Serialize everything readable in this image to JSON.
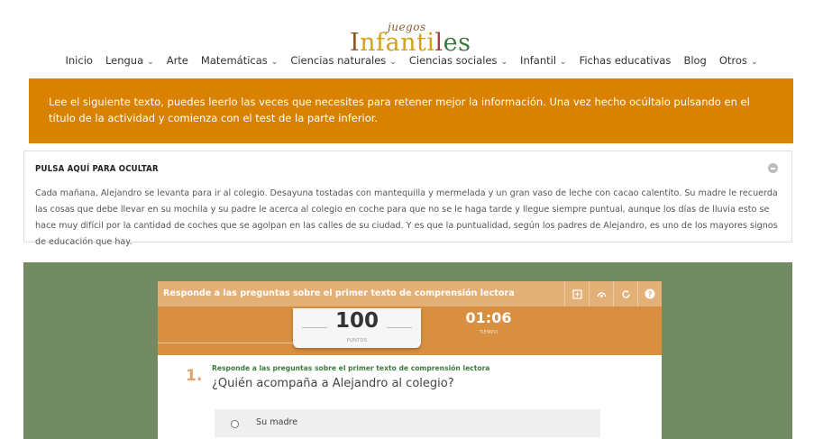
{
  "logo": {
    "small": "juegos",
    "main_parts": [
      "I",
      "nfanti",
      "l",
      "es"
    ]
  },
  "nav": {
    "items": [
      {
        "label": "Inicio",
        "chevron": false
      },
      {
        "label": "Lengua",
        "chevron": true
      },
      {
        "label": "Arte",
        "chevron": false
      },
      {
        "label": "Matemáticas",
        "chevron": true
      },
      {
        "label": "Ciencias naturales",
        "chevron": true
      },
      {
        "label": "Ciencias sociales",
        "chevron": true
      },
      {
        "label": "Infantil",
        "chevron": true
      },
      {
        "label": "Fichas educativas",
        "chevron": false
      },
      {
        "label": "Blog",
        "chevron": false
      },
      {
        "label": "Otros",
        "chevron": true
      }
    ],
    "chevron_glyph": "⌄"
  },
  "instructions": {
    "text": "Lee el siguiente texto, puedes leerlo las veces que necesites para retener mejor la información. Una vez hecho ocúltalo pulsando en el título de la actividad y comienza con el test de la parte inferior."
  },
  "reading": {
    "title": "PULSA AQUÍ PARA OCULTAR",
    "text": "Cada mañana, Alejandro se levanta para ir al colegio. Desayuna tostadas con mantequilla y mermelada y un gran vaso de leche con cacao calentito. Su madre le recuerda las cosas que debe llevar en su mochila y su padre le acerca al colegio en coche para que no se le haga tarde y llegue siempre puntual, aunque los días de lluvia esto se hace muy difícil por la cantidad de coches que se agolpan en las calles de su ciudad. Y es que la puntualidad, según los padres de Alejandro, es uno de los mayores signos de educación que hay."
  },
  "quiz": {
    "title": "Responde a las preguntas sobre el primer texto de comprensión lectora",
    "icons": [
      "fullscreen-icon",
      "stats-icon",
      "restart-icon",
      "help-icon"
    ],
    "score": {
      "value": "100",
      "label": "PUNTOS"
    },
    "timer": {
      "value": "01:06",
      "label": "TIEMPO"
    },
    "question": {
      "number": "1.",
      "subtitle": "Responde a las preguntas sobre el primer texto de comprensión lectora",
      "text": "¿Quién acompaña a Alejandro al colegio?",
      "options": [
        "Su madre"
      ]
    }
  },
  "colors": {
    "accent_orange": "#d98200",
    "quiz_header": "#e3b077",
    "score_band": "#d88f40",
    "green_panel": "#738b62",
    "question_green": "#3e7a3e"
  }
}
